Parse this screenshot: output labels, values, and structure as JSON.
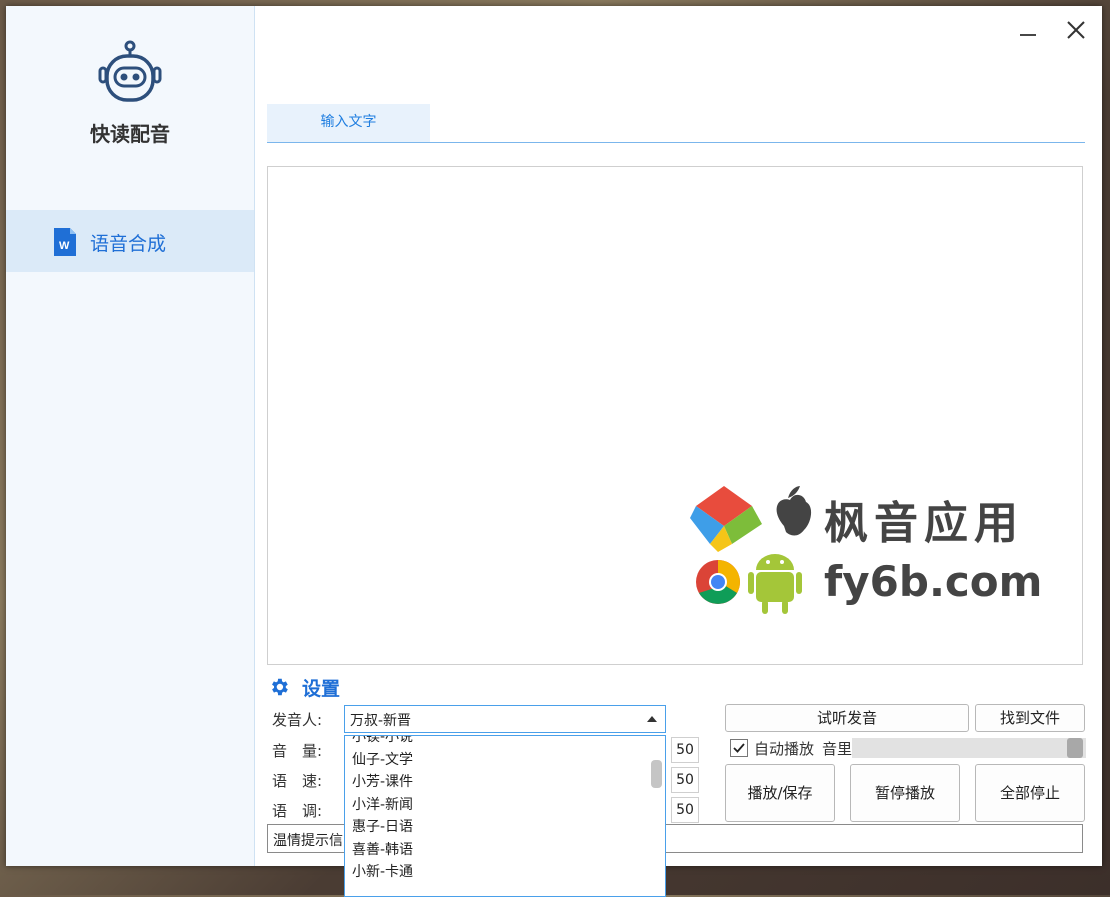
{
  "app": {
    "name": "快读配音"
  },
  "sidebar": {
    "items": [
      {
        "label": "语音合成",
        "icon": "word-document-icon",
        "active": true
      }
    ]
  },
  "window_controls": {
    "minimize_icon": "minimize-icon",
    "close_icon": "close-icon"
  },
  "tabs": [
    {
      "label": "输入文字",
      "active": true
    }
  ],
  "text_input": {
    "value": ""
  },
  "watermark": {
    "line1": "枫音应用",
    "line2": "fy6b.com"
  },
  "settings": {
    "title": "设置",
    "voice_label": "发音人:",
    "voice_value": "万叔-新晋",
    "voice_options": [
      "小镁-小说",
      "仙子-文学",
      "小芳-课件",
      "小洋-新闻",
      "惠子-日语",
      "喜善-韩语",
      "小新-卡通"
    ],
    "volume_label": "音　量:",
    "volume_value": "50",
    "speed_label": "语　速:",
    "speed_value": "50",
    "pitch_label": "语　调:",
    "pitch_value": "50",
    "hint_text": "温情提示信"
  },
  "actions": {
    "preview_label": "试听发音",
    "find_file_label": "找到文件",
    "auto_play_label": "自动播放",
    "auto_play_checked": true,
    "playback_volume_label": "音里",
    "play_save_label": "播放/保存",
    "pause_label": "暂停播放",
    "stop_all_label": "全部停止"
  },
  "colors": {
    "accent": "#1f6fd6",
    "sidebar_bg": "#f3f8fd",
    "nav_active_bg": "#dbeaf8"
  }
}
